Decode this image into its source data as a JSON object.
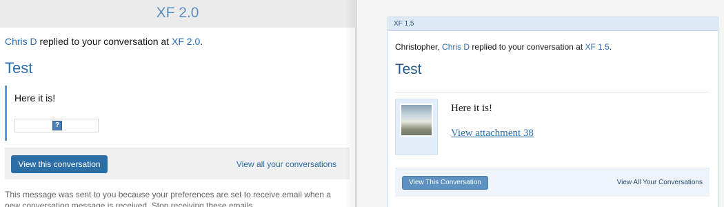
{
  "left": {
    "header_title": "XF 2.0",
    "intro": {
      "user": "Chris D",
      "middle": " replied to your conversation at ",
      "site": "XF 2.0",
      "end": "."
    },
    "title": "Test",
    "message": "Here it is!",
    "attachment_icon": "?",
    "view_button": "View this conversation",
    "view_all_link": "View all your conversations",
    "footer": "This message was sent to you because your preferences are set to receive email when a new conversation message is received. Stop receiving these emails."
  },
  "right": {
    "header_title": "XF 1.5",
    "intro": {
      "prefix": "Christopher, ",
      "user": "Chris D",
      "middle": " replied to your conversation at ",
      "site": "XF 1.5",
      "end": "."
    },
    "title": "Test",
    "message": "Here it is!",
    "attachment_link": "View attachment 38",
    "view_button": "View This Conversation",
    "view_all_link": "View All Your Conversations"
  },
  "colors": {
    "link": "#2b6cae",
    "primary_button": "#2c6ea6",
    "xf15_button": "#5d91c2",
    "xf15_header": "#dde9f5"
  }
}
